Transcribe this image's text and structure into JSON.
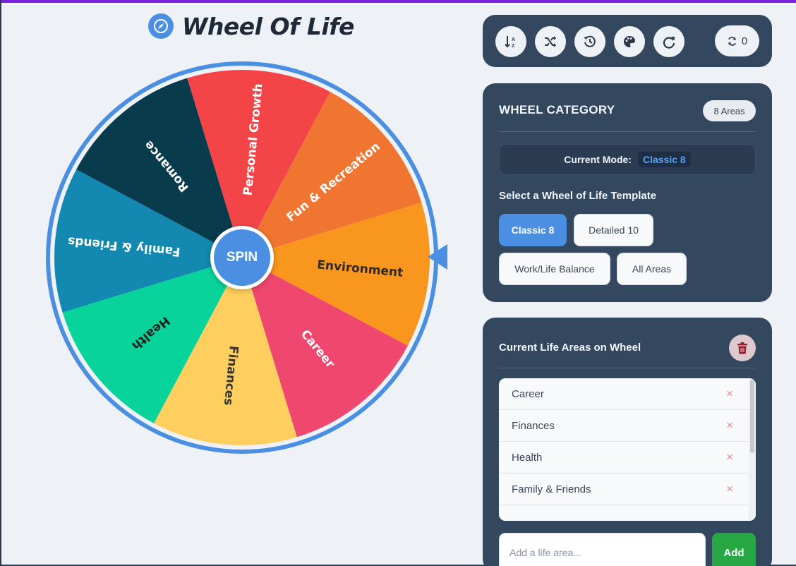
{
  "app": {
    "title": "Wheel Of Life",
    "title_icon": "compass-icon",
    "accent": "#4a8fe2"
  },
  "wheel": {
    "spin_label": "SPIN",
    "segments": [
      {
        "label": "Personal Growth",
        "color": "#f34448",
        "text_color": "#ffffff"
      },
      {
        "label": "Fun & Recreation",
        "color": "#f07530",
        "text_color": "#ffffff"
      },
      {
        "label": "Environment",
        "color": "#f8961e",
        "text_color": "#2a2a2a"
      },
      {
        "label": "Career",
        "color": "#f0476f",
        "text_color": "#ffffff"
      },
      {
        "label": "Finances",
        "color": "#fecf5e",
        "text_color": "#333333"
      },
      {
        "label": "Health",
        "color": "#07d39a",
        "text_color": "#222222"
      },
      {
        "label": "Family & Friends",
        "color": "#1388b0",
        "text_color": "#ffffff"
      },
      {
        "label": "Romance",
        "color": "#083b4c",
        "text_color": "#ffffff"
      }
    ]
  },
  "toolbar": {
    "buttons": [
      {
        "name": "sort-icon"
      },
      {
        "name": "shuffle-icon"
      },
      {
        "name": "history-icon"
      },
      {
        "name": "palette-icon"
      },
      {
        "name": "redo-icon"
      }
    ],
    "spin_counter_icon": "refresh-icon",
    "spin_count": "0"
  },
  "category": {
    "title": "WHEEL CATEGORY",
    "badge": "8 Areas",
    "mode_label": "Current Mode:",
    "mode_value": "Classic 8",
    "template_heading": "Select a Wheel of Life Template",
    "templates": [
      {
        "label": "Classic 8",
        "active": true
      },
      {
        "label": "Detailed 10",
        "active": false
      },
      {
        "label": "Work/Life Balance",
        "active": false
      },
      {
        "label": "All Areas",
        "active": false
      }
    ]
  },
  "areas": {
    "title": "Current Life Areas on Wheel",
    "clear_icon": "trash-icon",
    "items": [
      "Career",
      "Finances",
      "Health",
      "Family & Friends"
    ],
    "remove_glyph": "×",
    "input_placeholder": "Add a life area...",
    "add_label": "Add"
  }
}
